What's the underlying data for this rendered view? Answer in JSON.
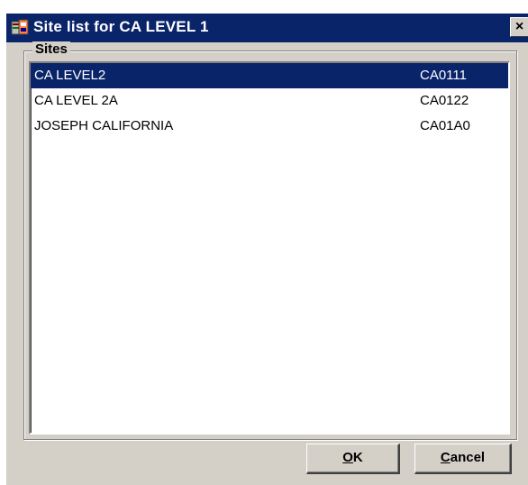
{
  "window": {
    "title": "Site list for CA LEVEL 1",
    "close_label": "×"
  },
  "group": {
    "label": "Sites"
  },
  "sites": [
    {
      "name": "CA LEVEL2",
      "code": "CA0111",
      "selected": true
    },
    {
      "name": "CA LEVEL 2A",
      "code": "CA0122",
      "selected": false
    },
    {
      "name": "JOSEPH CALIFORNIA",
      "code": "CA01A0",
      "selected": false
    }
  ],
  "buttons": {
    "ok_accel": "O",
    "ok_rest": "K",
    "cancel_accel": "C",
    "cancel_rest": "ancel"
  },
  "colors": {
    "titlebar": "#0a246a",
    "selection": "#0a246a",
    "face": "#d4d0c8"
  },
  "icons": {
    "title": "app-window-icon",
    "close": "close-icon"
  }
}
